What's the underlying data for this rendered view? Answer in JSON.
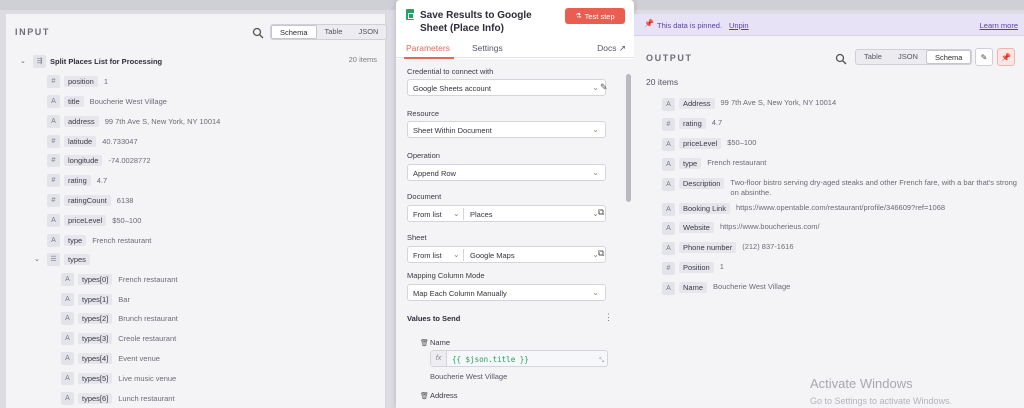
{
  "input": {
    "title": "INPUT",
    "view_tabs": [
      "Schema",
      "Table",
      "JSON"
    ],
    "node_name": "Split Places List for Processing",
    "items_count": "20 items",
    "fields": [
      {
        "type": "#",
        "key": "position",
        "value": "1"
      },
      {
        "type": "A",
        "key": "title",
        "value": "Boucherie West Village"
      },
      {
        "type": "A",
        "key": "address",
        "value": "99 7th Ave S, New York, NY 10014"
      },
      {
        "type": "#",
        "key": "latitude",
        "value": "40.733047"
      },
      {
        "type": "#",
        "key": "longitude",
        "value": "-74.0028772"
      },
      {
        "type": "#",
        "key": "rating",
        "value": "4.7"
      },
      {
        "type": "#",
        "key": "ratingCount",
        "value": "6138"
      },
      {
        "type": "A",
        "key": "priceLevel",
        "value": "$50–100"
      },
      {
        "type": "A",
        "key": "type",
        "value": "French restaurant"
      }
    ],
    "types_label": "types",
    "types": [
      {
        "key": "types[0]",
        "value": "French restaurant"
      },
      {
        "key": "types[1]",
        "value": "Bar"
      },
      {
        "key": "types[2]",
        "value": "Brunch restaurant"
      },
      {
        "key": "types[3]",
        "value": "Creole restaurant"
      },
      {
        "key": "types[4]",
        "value": "Event venue"
      },
      {
        "key": "types[5]",
        "value": "Live music venue"
      },
      {
        "key": "types[6]",
        "value": "Lunch restaurant"
      }
    ]
  },
  "node": {
    "name": "Save Results to Google Sheet (Place Info)",
    "test_step_label": "Test step",
    "tabs": [
      "Parameters",
      "Settings"
    ],
    "docs_label": "Docs",
    "credential_label": "Credential to connect with",
    "credential_value": "Google Sheets account",
    "resource_label": "Resource",
    "resource_value": "Sheet Within Document",
    "operation_label": "Operation",
    "operation_value": "Append Row",
    "document_label": "Document",
    "document_mode": "From list",
    "document_value": "Places",
    "sheet_label": "Sheet",
    "sheet_mode": "From list",
    "sheet_value": "Google Maps",
    "mapping_label": "Mapping Column Mode",
    "mapping_value": "Map Each Column Manually",
    "values_title": "Values to Send",
    "name_label": "Name",
    "name_expression": "{{ $json.title }}",
    "name_preview": "Boucherie West Village",
    "address_label": "Address"
  },
  "output": {
    "pinned_text": "This data is pinned.",
    "unpin_label": "Unpin",
    "learn_more_label": "Learn more",
    "title": "OUTPUT",
    "view_tabs": [
      "Table",
      "JSON",
      "Schema"
    ],
    "items_count": "20 items",
    "fields": [
      {
        "type": "A",
        "key": "Address",
        "value": "99 7th Ave S, New York, NY 10014"
      },
      {
        "type": "#",
        "key": "rating",
        "value": "4.7"
      },
      {
        "type": "A",
        "key": "priceLevel",
        "value": "$50–100"
      },
      {
        "type": "A",
        "key": "type",
        "value": "French restaurant"
      },
      {
        "type": "A",
        "key": "Description",
        "value": "Two-floor bistro serving dry-aged steaks and other French fare, with a bar that's strong on absinthe."
      },
      {
        "type": "A",
        "key": "Booking Link",
        "value": "https://www.opentable.com/restaurant/profile/346609?ref=1068"
      },
      {
        "type": "A",
        "key": "Website",
        "value": "https://www.boucherieus.com/"
      },
      {
        "type": "A",
        "key": "Phone number",
        "value": "(212) 837-1616"
      },
      {
        "type": "#",
        "key": "Position",
        "value": "1"
      },
      {
        "type": "A",
        "key": "Name",
        "value": "Boucherie West Village"
      }
    ]
  },
  "watermark": {
    "title": "Activate Windows",
    "subtitle": "Go to Settings to activate Windows."
  }
}
